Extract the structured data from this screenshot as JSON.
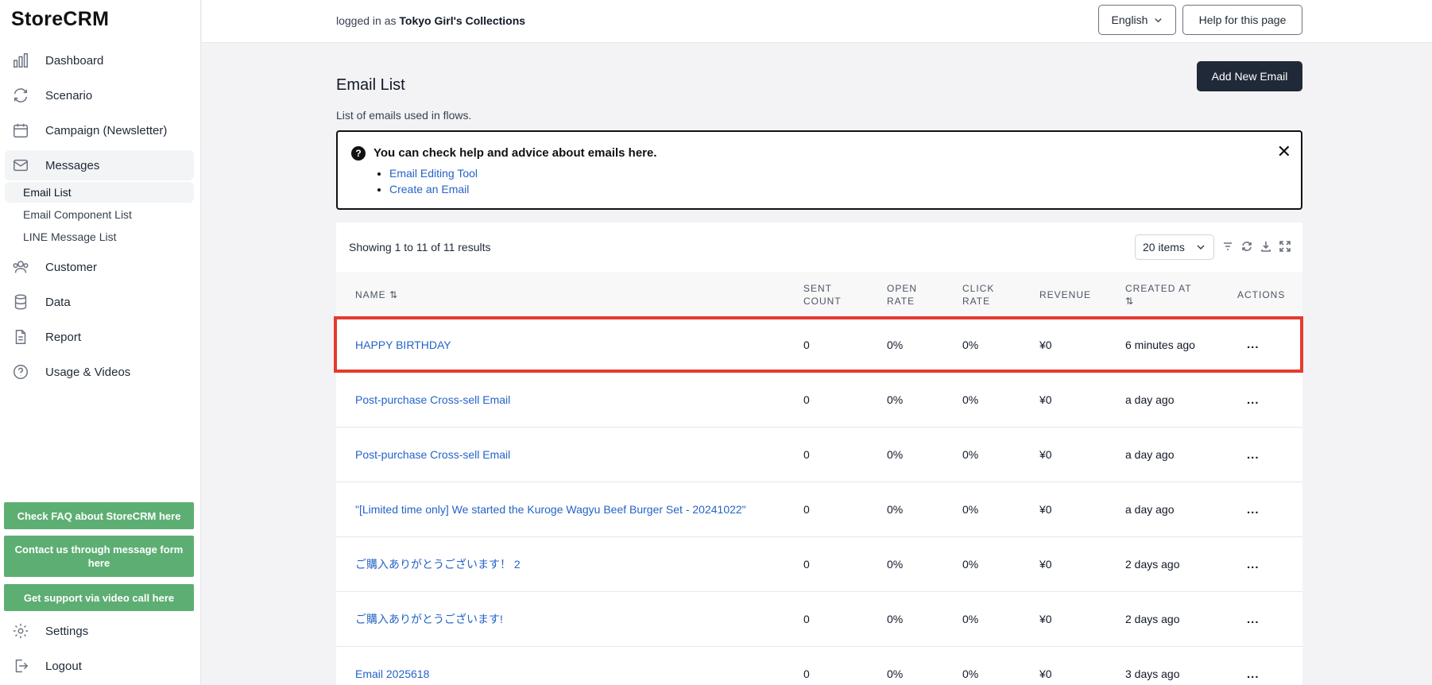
{
  "app": {
    "logo": "StoreCRM"
  },
  "sidebar": {
    "items": [
      {
        "label": "Dashboard",
        "icon": "bar-chart-icon"
      },
      {
        "label": "Scenario",
        "icon": "refresh-icon"
      },
      {
        "label": "Campaign (Newsletter)",
        "icon": "calendar-icon"
      },
      {
        "label": "Messages",
        "icon": "mail-icon"
      },
      {
        "label": "Customer",
        "icon": "users-icon"
      },
      {
        "label": "Data",
        "icon": "database-icon"
      },
      {
        "label": "Report",
        "icon": "document-icon"
      },
      {
        "label": "Usage & Videos",
        "icon": "question-circle-icon"
      }
    ],
    "sub_items": [
      "Email List",
      "Email Component List",
      "LINE Message List"
    ],
    "help_buttons": [
      "Check FAQ about StoreCRM here",
      "Contact us through message form here",
      "Get support via video call here"
    ],
    "bottom": [
      {
        "label": "Settings",
        "icon": "gear-icon"
      },
      {
        "label": "Logout",
        "icon": "logout-icon"
      }
    ]
  },
  "header": {
    "logged_prefix": "logged in as",
    "account": "Tokyo Girl's Collections",
    "language": "English",
    "help": "Help for this page"
  },
  "main": {
    "title": "Email List",
    "description": "List of emails used in flows.",
    "add_button": "Add New Email",
    "help_box": {
      "title": "You can check help and advice about emails here.",
      "links": [
        "Email Editing Tool",
        "Create an Email"
      ]
    },
    "table": {
      "showing": "Showing 1 to 11 of 11 results",
      "page_size": "20 items",
      "headers": {
        "name": "NAME ⇅",
        "sent_1": "SENT",
        "sent_2": "COUNT",
        "open_1": "OPEN",
        "open_2": "RATE",
        "click_1": "CLICK",
        "click_2": "RATE",
        "revenue": "REVENUE",
        "created_1": "CREATED AT",
        "created_2": "⇅",
        "actions": "ACTIONS"
      },
      "rows": [
        {
          "name": "HAPPY BIRTHDAY",
          "sent": "0",
          "open": "0%",
          "click": "0%",
          "revenue": "¥0",
          "created": "6 minutes ago",
          "actions": "..."
        },
        {
          "name": "Post-purchase Cross-sell Email",
          "sent": "0",
          "open": "0%",
          "click": "0%",
          "revenue": "¥0",
          "created": "a day ago",
          "actions": "..."
        },
        {
          "name": "Post-purchase Cross-sell Email",
          "sent": "0",
          "open": "0%",
          "click": "0%",
          "revenue": "¥0",
          "created": "a day ago",
          "actions": "..."
        },
        {
          "name": "\"[Limited time only] We started the Kuroge Wagyu Beef Burger Set - 20241022\"",
          "sent": "0",
          "open": "0%",
          "click": "0%",
          "revenue": "¥0",
          "created": "a day ago",
          "actions": "..."
        },
        {
          "name": "ご購入ありがとうございます！ 2",
          "sent": "0",
          "open": "0%",
          "click": "0%",
          "revenue": "¥0",
          "created": "2 days ago",
          "actions": "..."
        },
        {
          "name": "ご購入ありがとうございます!",
          "sent": "0",
          "open": "0%",
          "click": "0%",
          "revenue": "¥0",
          "created": "2 days ago",
          "actions": "..."
        },
        {
          "name": "Email 2025618",
          "sent": "0",
          "open": "0%",
          "click": "0%",
          "revenue": "¥0",
          "created": "3 days ago",
          "actions": "..."
        }
      ]
    }
  },
  "colors": {
    "accent_green": "#5dae73",
    "link_blue": "#2563c9",
    "highlight_red": "#e53b2c",
    "dark_button": "#1f2937"
  }
}
